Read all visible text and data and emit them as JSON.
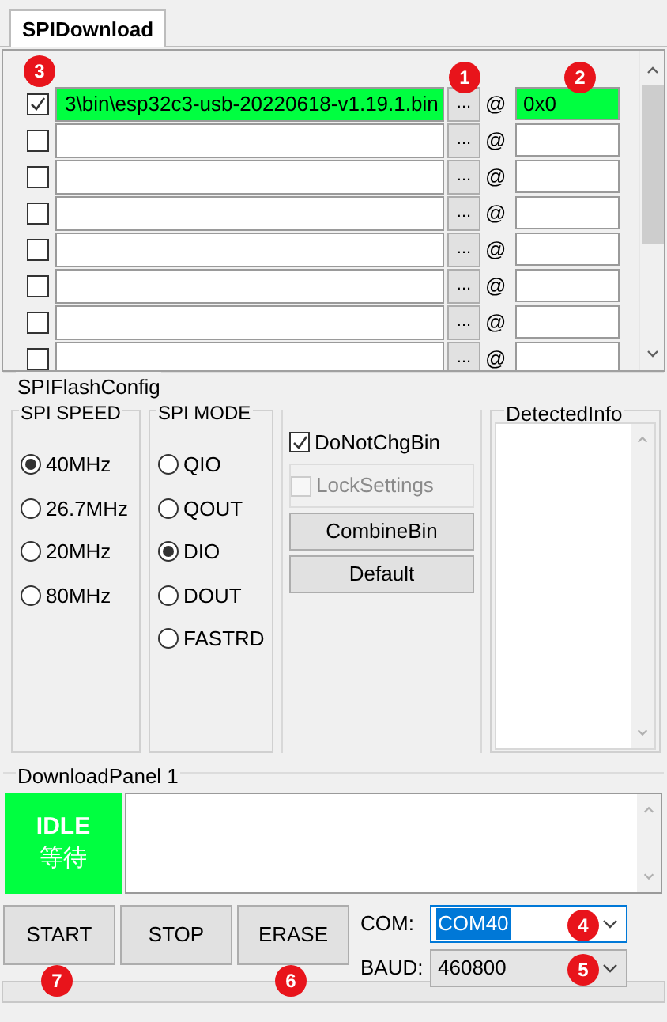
{
  "tabs": [
    {
      "label": "SPIDownload",
      "selected": true
    }
  ],
  "files": [
    {
      "checked": true,
      "path": "3\\bin\\esp32c3-usb-20220618-v1.19.1.bin",
      "browse": "...",
      "at": "@",
      "address": "0x0",
      "valid": true,
      "badge_checkbox": "3",
      "badge_browse": "1",
      "badge_address": "2"
    },
    {
      "checked": false,
      "browse": "...",
      "at": "@",
      "valid": false
    },
    {
      "checked": false,
      "browse": "...",
      "at": "@",
      "valid": false
    },
    {
      "checked": false,
      "browse": "...",
      "at": "@",
      "valid": false
    },
    {
      "checked": false,
      "browse": "...",
      "at": "@",
      "valid": false
    },
    {
      "checked": false,
      "browse": "...",
      "at": "@",
      "valid": false
    },
    {
      "checked": false,
      "browse": "...",
      "at": "@",
      "valid": false
    },
    {
      "checked": false,
      "browse": "...",
      "at": "@",
      "valid": false
    }
  ],
  "flash_config": {
    "title": "SPIFlashConfig",
    "speed": {
      "title": "SPI SPEED",
      "options": [
        {
          "label": "40MHz",
          "selected": true
        },
        {
          "label": "26.7MHz",
          "selected": false
        },
        {
          "label": "20MHz",
          "selected": false
        },
        {
          "label": "80MHz",
          "selected": false
        }
      ]
    },
    "mode": {
      "title": "SPI MODE",
      "options": [
        {
          "label": "QIO",
          "selected": false
        },
        {
          "label": "QOUT",
          "selected": false
        },
        {
          "label": "DIO",
          "selected": true
        },
        {
          "label": "DOUT",
          "selected": false
        },
        {
          "label": "FASTRD",
          "selected": false
        }
      ]
    },
    "checks": [
      {
        "label": "DoNotChgBin",
        "checked": true,
        "disabled": false
      },
      {
        "label": "LockSettings",
        "checked": false,
        "disabled": true
      }
    ],
    "buttons": [
      "CombineBin",
      "Default"
    ],
    "detected_info": {
      "title": "DetectedInfo"
    }
  },
  "download_panel": {
    "title": "DownloadPanel 1",
    "status": "IDLE",
    "status_cn": "等待"
  },
  "actions": [
    {
      "label": "START",
      "badge": "7"
    },
    {
      "label": "STOP"
    },
    {
      "label": "ERASE",
      "badge": "6"
    }
  ],
  "com": {
    "label": "COM:",
    "value": "COM40",
    "text_selected": true,
    "badge": "4"
  },
  "baud": {
    "label": "BAUD:",
    "value": "460800",
    "badge": "5"
  }
}
